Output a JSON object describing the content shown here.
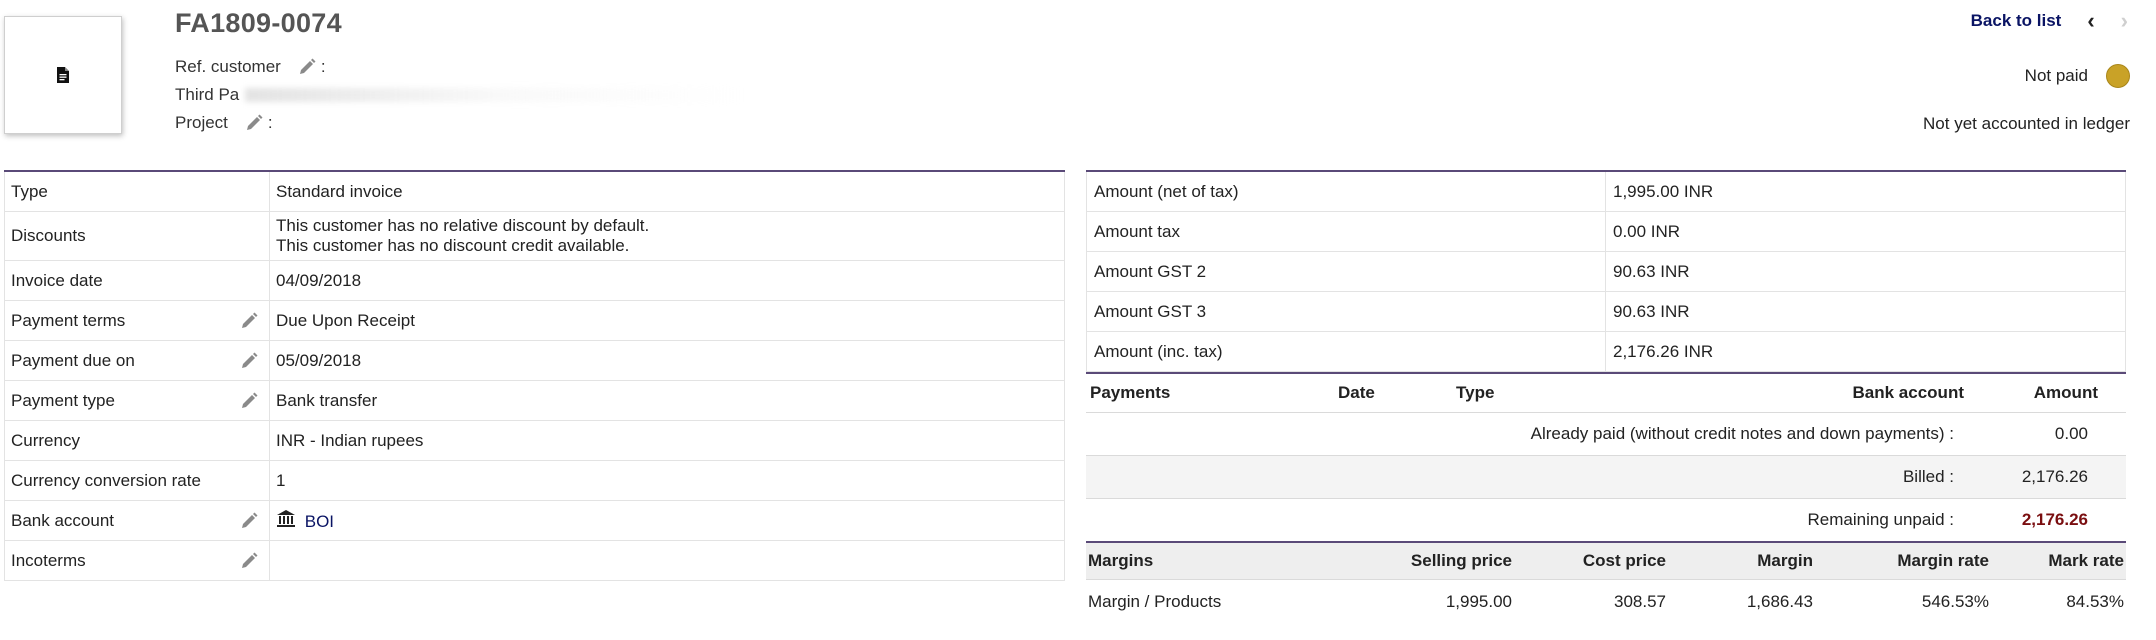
{
  "header": {
    "ref": "FA1809-0074",
    "ref_customer_label": "Ref. customer",
    "third_party_label": "Third Pa",
    "project_label": "Project",
    "colon": ":",
    "back_to_list": "Back to list",
    "prev": "‹",
    "next": "›",
    "status": "Not paid",
    "status_color": "#c9a227",
    "ledger_status": "Not yet accounted in ledger"
  },
  "info": {
    "type_label": "Type",
    "type_value": "Standard invoice",
    "discounts_label": "Discounts",
    "discounts_line1": "This customer has no relative discount by default.",
    "discounts_line2": "This customer has no discount credit available.",
    "invoice_date_label": "Invoice date",
    "invoice_date_value": "04/09/2018",
    "payment_terms_label": "Payment terms",
    "payment_terms_value": "Due Upon Receipt",
    "payment_due_label": "Payment due on",
    "payment_due_value": "05/09/2018",
    "payment_type_label": "Payment type",
    "payment_type_value": "Bank transfer",
    "currency_label": "Currency",
    "currency_value": "INR - Indian rupees",
    "conversion_label": "Currency conversion rate",
    "conversion_value": "1",
    "bank_label": "Bank account",
    "bank_value": "BOI",
    "incoterms_label": "Incoterms",
    "incoterms_value": ""
  },
  "amounts": {
    "net_label": "Amount (net of tax)",
    "net_value": "1,995.00 INR",
    "tax_label": "Amount tax",
    "tax_value": "0.00 INR",
    "gst2_label": "Amount GST 2",
    "gst2_value": "90.63 INR",
    "gst3_label": "Amount GST 3",
    "gst3_value": "90.63 INR",
    "inc_label": "Amount (inc. tax)",
    "inc_value": "2,176.26 INR"
  },
  "payments": {
    "headers": {
      "payments": "Payments",
      "date": "Date",
      "type": "Type",
      "bank": "Bank account",
      "amount": "Amount"
    },
    "already_paid_label": "Already paid (without credit notes and down payments) :",
    "already_paid_value": "0.00",
    "billed_label": "Billed :",
    "billed_value": "2,176.26",
    "remaining_label": "Remaining unpaid :",
    "remaining_value": "2,176.26",
    "remaining_color": "#7a0e10"
  },
  "margins": {
    "headers": {
      "margins": "Margins",
      "selling": "Selling price",
      "cost": "Cost price",
      "margin": "Margin",
      "margin_rate": "Margin rate",
      "mark_rate": "Mark rate"
    },
    "row": {
      "label": "Margin / Products",
      "selling": "1,995.00",
      "cost": "308.57",
      "margin": "1,686.43",
      "margin_rate": "546.53%",
      "mark_rate": "84.53%"
    }
  }
}
